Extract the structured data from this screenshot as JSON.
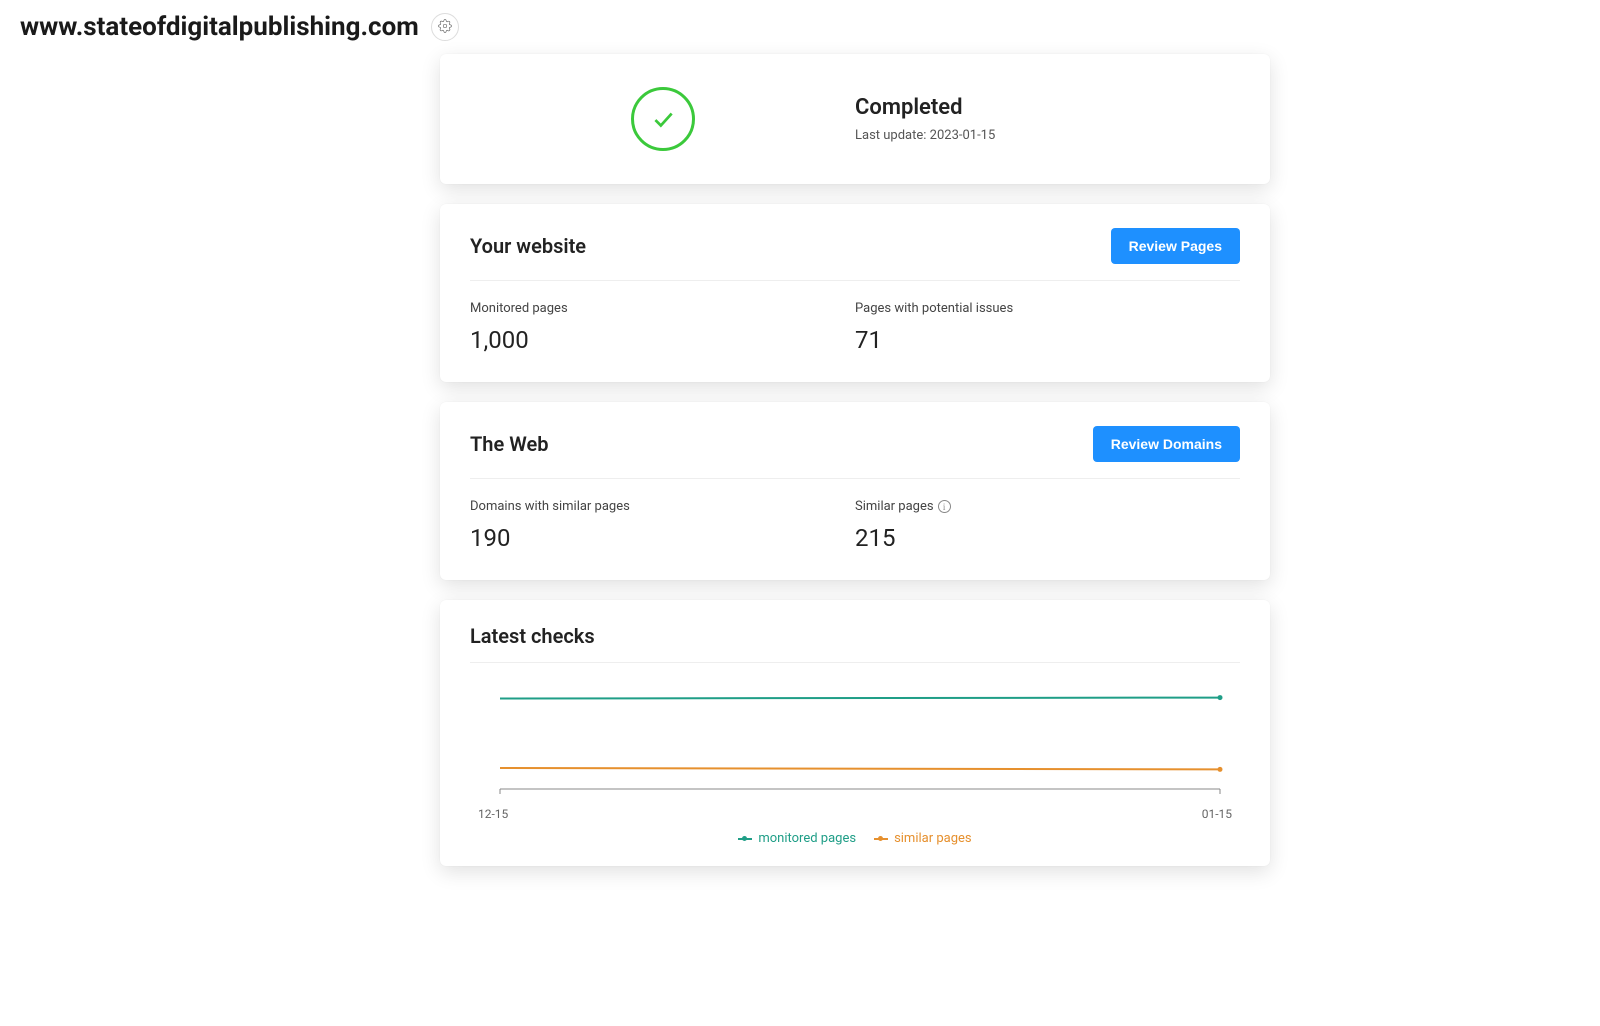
{
  "header": {
    "domain": "www.stateofdigitalpublishing.com"
  },
  "status": {
    "title": "Completed",
    "last_update_label": "Last update: 2023-01-15"
  },
  "your_website": {
    "title": "Your website",
    "button": "Review Pages",
    "monitored_label": "Monitored pages",
    "monitored_value": "1,000",
    "issues_label": "Pages with potential issues",
    "issues_value": "71"
  },
  "the_web": {
    "title": "The Web",
    "button": "Review Domains",
    "domains_label": "Domains with similar pages",
    "domains_value": "190",
    "similar_label": "Similar pages",
    "similar_value": "215"
  },
  "latest_checks": {
    "title": "Latest checks",
    "x_start": "12-15",
    "x_end": "01-15",
    "legend_monitored": "monitored pages",
    "legend_similar": "similar pages"
  },
  "chart_data": {
    "type": "line",
    "title": "Latest checks",
    "xlabel": "",
    "ylabel": "",
    "x": [
      "12-15",
      "01-15"
    ],
    "ylim": [
      0,
      1050
    ],
    "series": [
      {
        "name": "monitored pages",
        "values": [
          990,
          1000
        ],
        "color": "#1f9e87"
      },
      {
        "name": "similar pages",
        "values": [
          230,
          215
        ],
        "color": "#e6902e"
      }
    ],
    "legend_position": "bottom"
  },
  "colors": {
    "accent_blue": "#1e90ff",
    "success_green": "#3bc93b",
    "series_teal": "#1f9e87",
    "series_orange": "#e6902e"
  }
}
